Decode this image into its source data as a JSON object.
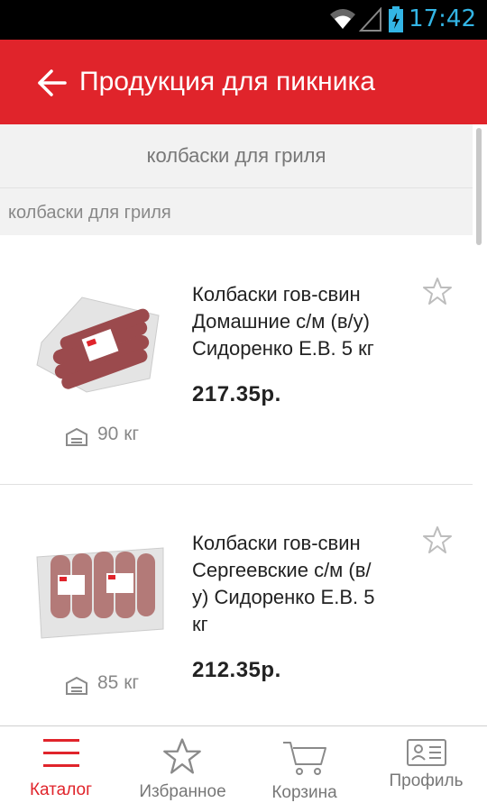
{
  "status_bar": {
    "time": "17:42"
  },
  "header": {
    "title": "Продукция для пикника"
  },
  "subheader": {
    "title": "колбаски для гриля"
  },
  "breadcrumb": {
    "text": "колбаски для гриля"
  },
  "products": [
    {
      "name": "Колбаски гов-свин Домашние с/м (в/у) Сидоренко Е.В. 5 кг",
      "name_lines": [
        "Колбаски гов-свин",
        "Домашние с/м (в/у)",
        "Сидоренко Е.В. 5 кг"
      ],
      "price": "217.35р.",
      "stock": "90 кг"
    },
    {
      "name": "Колбаски гов-свин Сергеевские с/м (в/у) Сидоренко Е.В. 5 кг",
      "name_lines": [
        "Колбаски гов-свин",
        "Сергеевские с/м (в/",
        "у)  Сидоренко Е.В. 5",
        "кг"
      ],
      "price": "212.35р.",
      "stock": "85 кг"
    }
  ],
  "bottom_nav": {
    "catalog": "Каталог",
    "favorites": "Избранное",
    "cart": "Корзина",
    "profile": "Профиль"
  },
  "colors": {
    "accent": "#e0242b",
    "status_icon": "#33b5e5"
  }
}
